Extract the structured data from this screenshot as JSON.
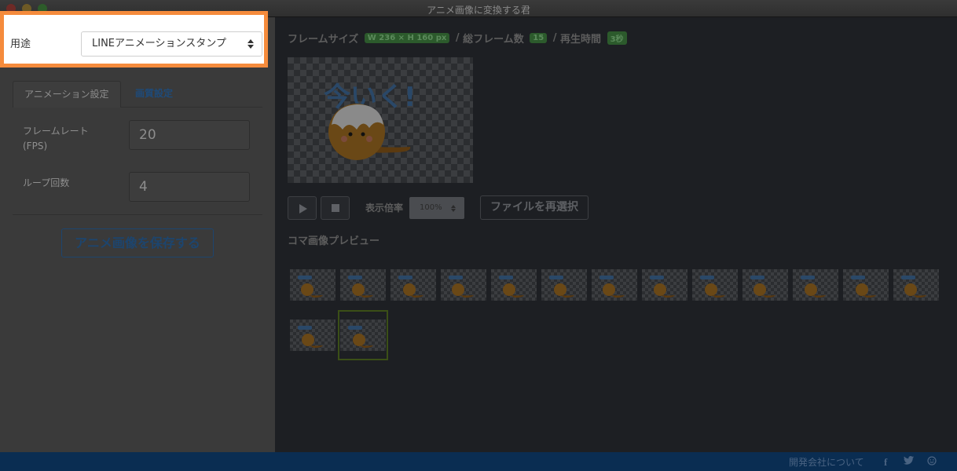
{
  "window": {
    "title": "アニメ画像に変換する君"
  },
  "purpose": {
    "label": "用途",
    "value": "LINEアニメーションスタンプ"
  },
  "tabs": [
    {
      "label": "アニメーション設定"
    },
    {
      "label": "画質設定"
    }
  ],
  "settings": {
    "fps_label_line1": "フレームレート",
    "fps_label_line2": "(FPS)",
    "fps_value": "20",
    "loop_label": "ループ回数",
    "loop_value": "4"
  },
  "save_button": "アニメ画像を保存する",
  "info": {
    "frame_size_label": "フレームサイズ",
    "frame_size_value": "W 236 × H 160 px",
    "sep1": "/",
    "total_frames_label": "総フレーム数",
    "total_frames_value": "15",
    "sep2": "/",
    "duration_label": "再生時間",
    "duration_value": "3秒"
  },
  "preview": {
    "text": "今いく!"
  },
  "controls": {
    "zoom_label": "表示倍率",
    "zoom_value": "100%",
    "reselect_label": "ファイルを再選択"
  },
  "frames": {
    "title": "コマ画像プレビュー",
    "count": 15,
    "selected_index": 14
  },
  "footer": {
    "company_link": "開発会社について"
  },
  "icons": {
    "play": "play-icon",
    "stop": "stop-icon",
    "facebook": "facebook-icon",
    "twitter": "twitter-icon",
    "smile": "smile-icon"
  },
  "colors": {
    "highlight": "#f58b3c",
    "link": "#1f4a78",
    "badge": "#2c5a2c",
    "statusbar": "#0a2d52"
  }
}
